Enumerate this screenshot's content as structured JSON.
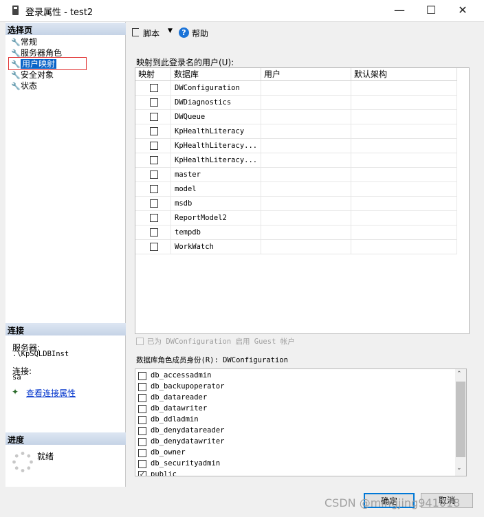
{
  "window": {
    "title": "登录属性 - test2"
  },
  "left": {
    "select_page_header": "选择页",
    "nav_items": [
      "常规",
      "服务器角色",
      "用户映射",
      "安全对象",
      "状态"
    ],
    "connection_header": "连接",
    "server_label": "服务器:",
    "server_value": ".\\KpSQLDBInst",
    "connection_label": "连接:",
    "connection_value": "sa",
    "view_connection_link": "查看连接属性",
    "progress_header": "进度",
    "progress_status": "就绪"
  },
  "toolbar": {
    "script_label": "脚本",
    "help_label": "帮助"
  },
  "mapping": {
    "label": "映射到此登录名的用户(U):",
    "columns": [
      "映射",
      "数据库",
      "用户",
      "默认架构"
    ],
    "rows": [
      {
        "db": "DWConfiguration",
        "checked": false
      },
      {
        "db": "DWDiagnostics",
        "checked": false
      },
      {
        "db": "DWQueue",
        "checked": false
      },
      {
        "db": "KpHealthLiteracy",
        "checked": false
      },
      {
        "db": "KpHealthLiteracy...",
        "checked": false
      },
      {
        "db": "KpHealthLiteracy...",
        "checked": false
      },
      {
        "db": "master",
        "checked": false
      },
      {
        "db": "model",
        "checked": false
      },
      {
        "db": "msdb",
        "checked": false
      },
      {
        "db": "ReportModel2",
        "checked": false
      },
      {
        "db": "tempdb",
        "checked": false
      },
      {
        "db": "WorkWatch",
        "checked": false
      }
    ],
    "guest_label": "已为 DWConfiguration 启用 Guest 帐户"
  },
  "roles": {
    "label": "数据库角色成员身份(R): DWConfiguration",
    "items": [
      {
        "name": "db_accessadmin",
        "checked": false
      },
      {
        "name": "db_backupoperator",
        "checked": false
      },
      {
        "name": "db_datareader",
        "checked": false
      },
      {
        "name": "db_datawriter",
        "checked": false
      },
      {
        "name": "db_ddladmin",
        "checked": false
      },
      {
        "name": "db_denydatareader",
        "checked": false
      },
      {
        "name": "db_denydatawriter",
        "checked": false
      },
      {
        "name": "db_owner",
        "checked": false
      },
      {
        "name": "db_securityadmin",
        "checked": false
      },
      {
        "name": "public",
        "checked": true
      }
    ]
  },
  "buttons": {
    "ok": "确定",
    "cancel": "取消"
  },
  "watermark": "CSDN @mingjing941018"
}
